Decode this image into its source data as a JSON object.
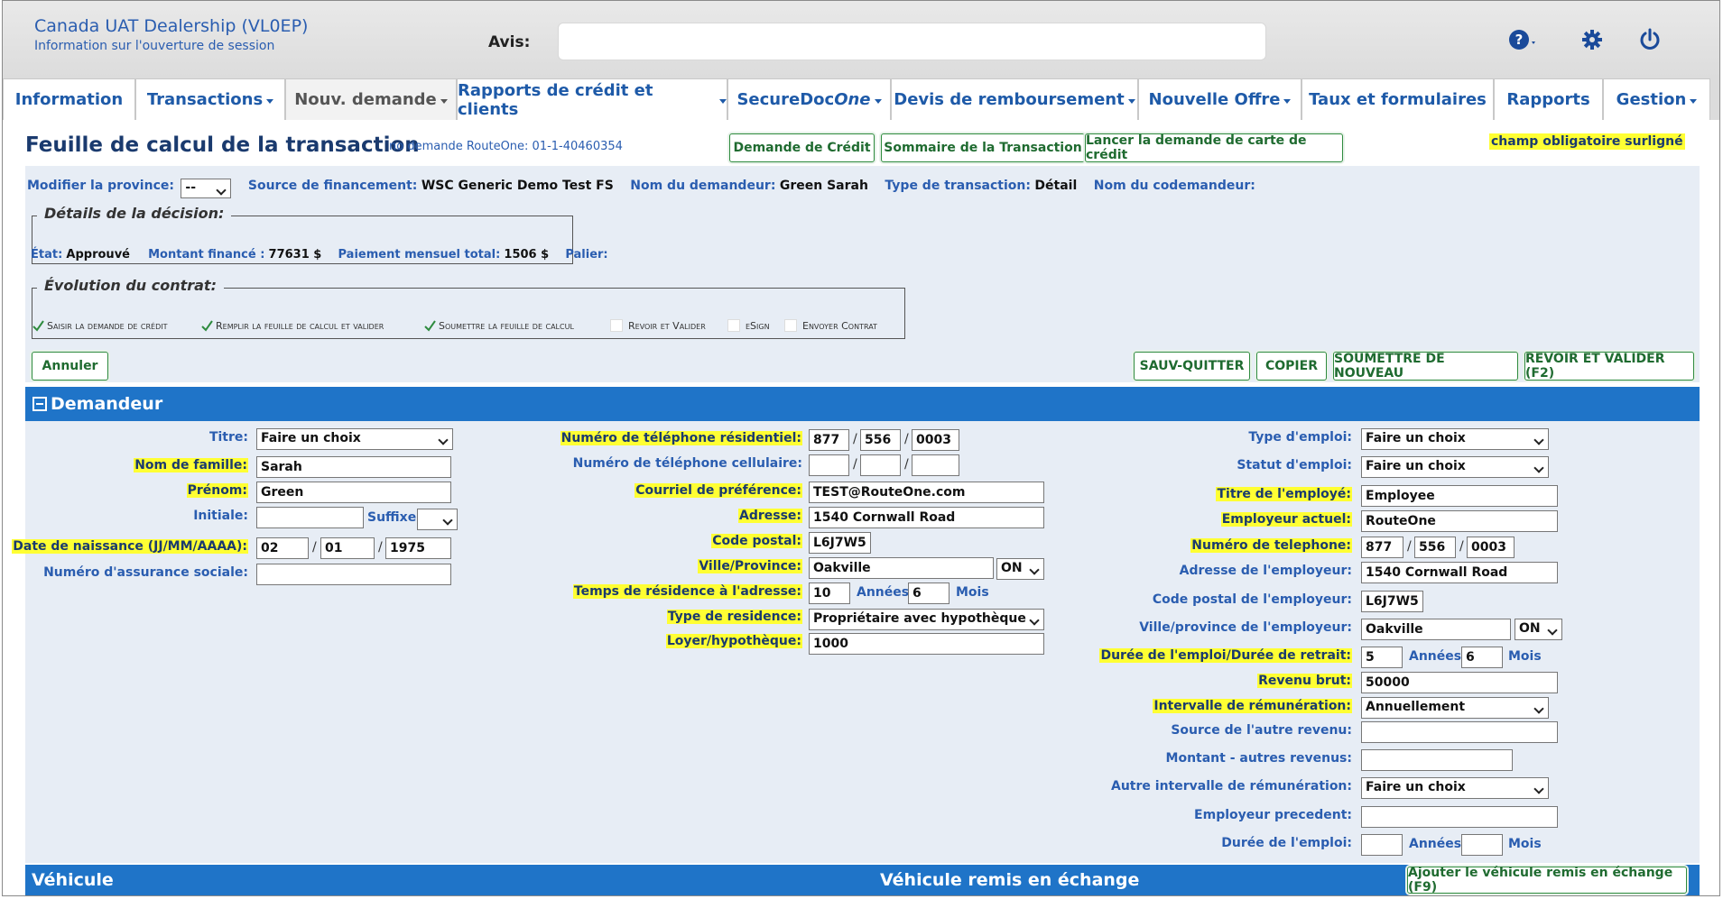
{
  "header": {
    "dealership": "Canada UAT Dealership (VL0EP)",
    "session_info": "Information sur l'ouverture de session",
    "avis_label": "Avis:"
  },
  "tabs": [
    {
      "label": "Information"
    },
    {
      "label": "Transactions"
    },
    {
      "label": "Nouv. demande"
    },
    {
      "label": "Rapports de crédit et clients"
    },
    {
      "label": "SecureDoc",
      "label_italic": "One"
    },
    {
      "label": "Devis de remboursement"
    },
    {
      "label": "Nouvelle Offre"
    },
    {
      "label": "Taux et formulaires"
    },
    {
      "label": "Rapports"
    },
    {
      "label": "Gestion"
    }
  ],
  "page": {
    "title": "Feuille de calcul de la transaction",
    "request_no": "no demande RouteOne: 01-1-40460354",
    "btn_credit": "Demande de Crédit",
    "btn_summary": "Sommaire de la Transaction",
    "btn_card": "Lancer la demande de carte de crédit",
    "mandatory": "champ obligatoire surligné"
  },
  "info": {
    "province_label": "Modifier la province:",
    "province_value": "--",
    "source_label": "Source de financement:",
    "source_value": "WSC Generic Demo Test FS",
    "applicant_label": "Nom du demandeur:",
    "applicant_value": "Green Sarah",
    "type_label": "Type de transaction:",
    "type_value": "Détail",
    "coapplicant_label": "Nom du codemandeur:"
  },
  "decision": {
    "legend": "Détails de la décision:",
    "etat_label": "État:",
    "etat_value": "Approuvé",
    "montant_label": "Montant financé :",
    "montant_value": "77631 $",
    "paiement_label": "Paiement mensuel total:",
    "paiement_value": "1506 $",
    "palier_label": "Palier:"
  },
  "contract": {
    "legend": "Évolution du contrat:",
    "steps": [
      {
        "label": "Saisir la demande de crédit",
        "done": true
      },
      {
        "label": "Remplir la feuille de calcul et valider",
        "done": true
      },
      {
        "label": "Soumettre la feuille de calcul",
        "done": true
      },
      {
        "label": "Revoir et Valider",
        "done": false
      },
      {
        "label": "eSign",
        "done": false
      },
      {
        "label": "Envoyer Contrat",
        "done": false
      }
    ]
  },
  "actions": {
    "annuler": "Annuler",
    "sauv_quitter": "SAUV-QUITTER",
    "copier": "COPIER",
    "soumettre": "SOUMETTRE DE NOUVEAU",
    "revoir": "REVOIR ET VALIDER (F2)"
  },
  "demandeur": {
    "section_title": "Demandeur",
    "titre_label": "Titre:",
    "titre_value": "Faire un choix",
    "nom_label": "Nom de famille:",
    "nom_value": "Sarah",
    "prenom_label": "Prénom:",
    "prenom_value": "Green",
    "initiale_label": "Initiale:",
    "initiale_value": "",
    "suffixe_label": "Suffixe:",
    "suffixe_value": "",
    "dob_label": "Date de naissance (JJ/MM/AAAA):",
    "dob_dd": "02",
    "dob_mm": "01",
    "dob_yyyy": "1975",
    "nas_label": "Numéro d'assurance sociale:",
    "nas_value": "",
    "tel_res_label": "Numéro de téléphone résidentiel:",
    "tel_res_1": "877",
    "tel_res_2": "556",
    "tel_res_3": "0003",
    "tel_cell_label": "Numéro de téléphone cellulaire:",
    "tel_cell_1": "",
    "tel_cell_2": "",
    "tel_cell_3": "",
    "courriel_label": "Courriel de préférence:",
    "courriel_value": "TEST@RouteOne.com",
    "adresse_label": "Adresse:",
    "adresse_value": "1540 Cornwall Road",
    "cp_label": "Code postal:",
    "cp_value": "L6J7W5",
    "ville_label": "Ville/Province:",
    "ville_value": "Oakville",
    "prov_value": "ON",
    "temps_label": "Temps de résidence à l'adresse:",
    "temps_annees": "10",
    "annees_label": "Années",
    "temps_mois": "6",
    "mois_label": "Mois",
    "type_res_label": "Type de residence:",
    "type_res_value": "Propriétaire avec hypothèque",
    "loyer_label": "Loyer/hypothèque:",
    "loyer_value": "1000",
    "type_emploi_label": "Type d'emploi:",
    "type_emploi_value": "Faire un choix",
    "statut_label": "Statut d'emploi:",
    "statut_value": "Faire un choix",
    "titre_emp_label": "Titre de l'employé:",
    "titre_emp_value": "Employee",
    "employeur_label": "Employeur actuel:",
    "employeur_value": "RouteOne",
    "tel_emp_label": "Numéro de telephone:",
    "tel_emp_1": "877",
    "tel_emp_2": "556",
    "tel_emp_3": "0003",
    "adr_emp_label": "Adresse de l'employeur:",
    "adr_emp_value": "1540 Cornwall Road",
    "cp_emp_label": "Code postal de l'employeur:",
    "cp_emp_value": "L6J7W5",
    "ville_emp_label": "Ville/province de l'employeur:",
    "ville_emp_value": "Oakville",
    "prov_emp_value": "ON",
    "duree_label": "Durée de l'emploi/Durée de retrait:",
    "duree_annees": "5",
    "duree_mois": "6",
    "revenu_label": "Revenu brut:",
    "revenu_value": "50000",
    "intervalle_label": "Intervalle de rémunération:",
    "intervalle_value": "Annuellement",
    "source_autre_label": "Source de l'autre revenu:",
    "source_autre_value": "",
    "montant_autre_label": "Montant - autres revenus:",
    "montant_autre_value": "",
    "autre_int_label": "Autre intervalle de rémunération:",
    "autre_int_value": "Faire un choix",
    "emp_prec_label": "Employeur precedent:",
    "emp_prec_value": "",
    "duree_emp_label": "Durée de l'emploi:",
    "duree_emp_annees": "",
    "duree_emp_mois": ""
  },
  "vehicule": {
    "title": "Véhicule",
    "trade_title": "Véhicule remis en échange",
    "add_trade": "Ajouter le véhicule remis en échange (F9)"
  }
}
